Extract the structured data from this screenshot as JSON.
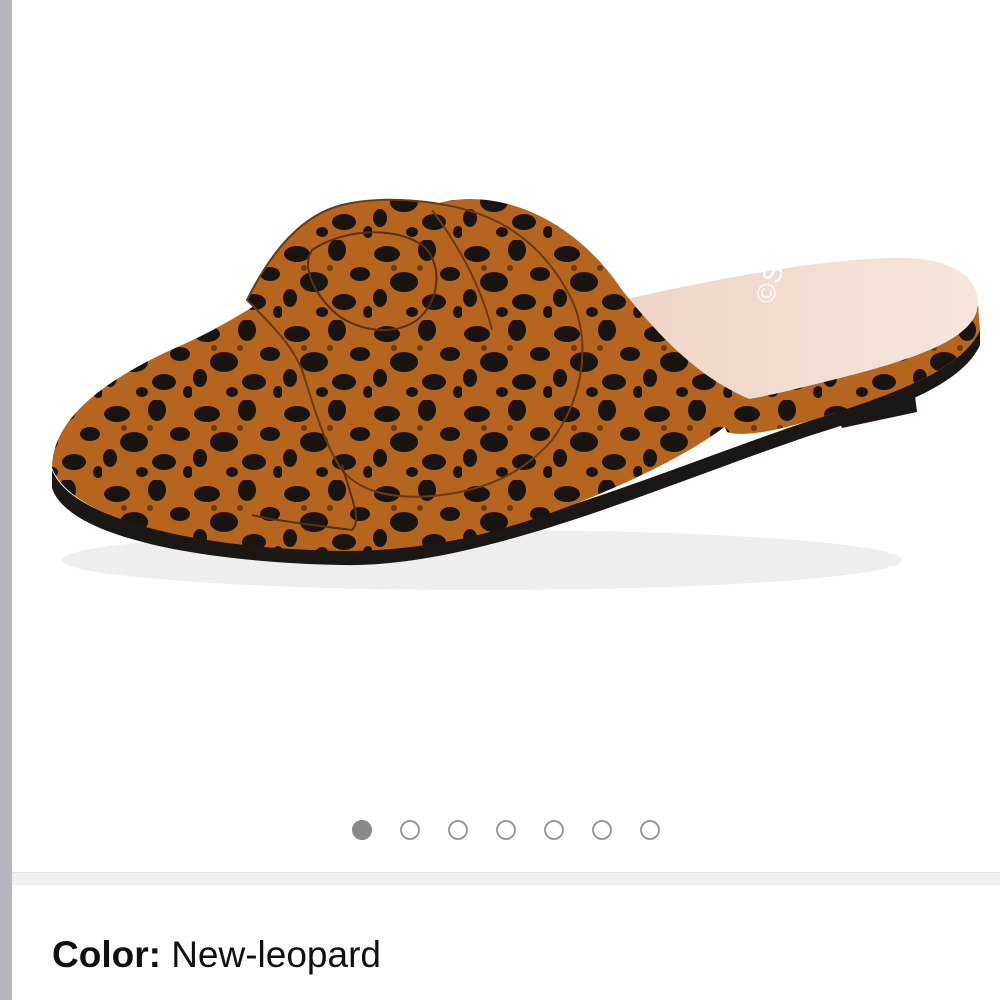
{
  "product_image": {
    "brand_imprint": "SANDALUP",
    "alt": "leopard-print-bow-mule-image"
  },
  "carousel": {
    "total": 7,
    "active_index": 0
  },
  "color_selector": {
    "label": "Color:",
    "value": "New-leopard"
  },
  "colors": {
    "dot_active": "#8a8a8a",
    "dot_inactive_border": "#9b9b9b",
    "leopard_base": "#b5651d",
    "leopard_spot": "#1a1410",
    "insole": "#f3dfd3",
    "divider": "#eef0f1"
  }
}
